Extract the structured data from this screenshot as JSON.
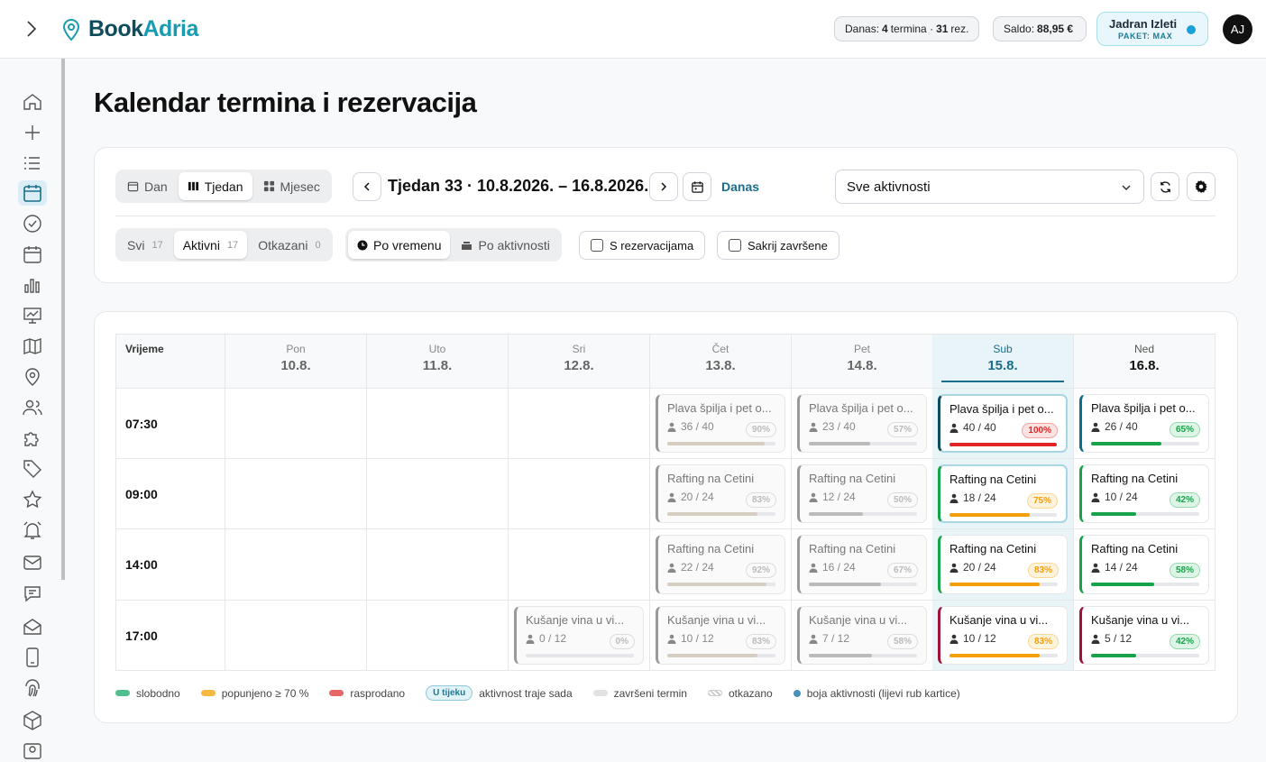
{
  "brand": {
    "part1": "Book",
    "part2": "Adria"
  },
  "header": {
    "today_label": "Danas:",
    "today_count": "4",
    "today_terms": "termina ·",
    "today_res": "31",
    "today_res_label": "rez.",
    "balance_label": "Saldo:",
    "balance_value": "88,95 €",
    "user_name": "Jadran Izleti",
    "user_plan": "PAKET: MAX",
    "avatar": "AJ"
  },
  "page": {
    "title": "Kalendar termina i rezervacija"
  },
  "toolbar": {
    "views": [
      "Dan",
      "Tjedan",
      "Mjesec"
    ],
    "week_title": "Tjedan 33 · 10.8.2026. – 16.8.2026.",
    "today_btn": "Danas",
    "activity_select": "Sve aktivnosti",
    "filters": [
      {
        "label": "Svi",
        "count": "17"
      },
      {
        "label": "Aktivni",
        "count": "17"
      },
      {
        "label": "Otkazani",
        "count": "0"
      }
    ],
    "sort": [
      "Po vremenu",
      "Po aktivnosti"
    ],
    "checks": [
      "S rezervacijama",
      "Sakrij završene"
    ]
  },
  "calendar": {
    "time_header": "Vrijeme",
    "days": [
      {
        "name": "Pon",
        "date": "10.8."
      },
      {
        "name": "Uto",
        "date": "11.8."
      },
      {
        "name": "Sri",
        "date": "12.8."
      },
      {
        "name": "Čet",
        "date": "13.8."
      },
      {
        "name": "Pet",
        "date": "14.8."
      },
      {
        "name": "Sub",
        "date": "15.8."
      },
      {
        "name": "Ned",
        "date": "16.8."
      }
    ],
    "times": [
      "07:30",
      "09:00",
      "14:00",
      "17:00"
    ],
    "events": [
      {
        "day": 3,
        "slot": 0,
        "title": "Plava špilja i pet o...",
        "count": "36 / 40",
        "pct": "90%",
        "fill": 90,
        "status": "past"
      },
      {
        "day": 4,
        "slot": 0,
        "title": "Plava špilja i pet o...",
        "count": "23 / 40",
        "pct": "57%",
        "fill": 57,
        "status": "past-gray"
      },
      {
        "day": 5,
        "slot": 0,
        "title": "Plava špilja i pet o...",
        "count": "40 / 40",
        "pct": "100%",
        "fill": 100,
        "status": "current",
        "bar_color": "#e02424",
        "edge": "#0f4c5c"
      },
      {
        "day": 6,
        "slot": 0,
        "title": "Plava špilja i pet o...",
        "count": "26 / 40",
        "pct": "65%",
        "fill": 65,
        "status": "active",
        "bar_color": "#16a34a",
        "edge": "#0f6e86"
      },
      {
        "day": 3,
        "slot": 1,
        "title": "Rafting na Cetini",
        "count": "20 / 24",
        "pct": "83%",
        "fill": 83,
        "status": "past"
      },
      {
        "day": 4,
        "slot": 1,
        "title": "Rafting na Cetini",
        "count": "12 / 24",
        "pct": "50%",
        "fill": 50,
        "status": "past-gray"
      },
      {
        "day": 5,
        "slot": 1,
        "title": "Rafting na Cetini",
        "count": "18 / 24",
        "pct": "75%",
        "fill": 75,
        "status": "current",
        "bar_color": "#f59e0b",
        "edge": "#16a34a"
      },
      {
        "day": 6,
        "slot": 1,
        "title": "Rafting na Cetini",
        "count": "10 / 24",
        "pct": "42%",
        "fill": 42,
        "status": "active",
        "bar_color": "#16a34a",
        "edge": "#16a34a"
      },
      {
        "day": 3,
        "slot": 2,
        "title": "Rafting na Cetini",
        "count": "22 / 24",
        "pct": "92%",
        "fill": 92,
        "status": "past"
      },
      {
        "day": 4,
        "slot": 2,
        "title": "Rafting na Cetini",
        "count": "16 / 24",
        "pct": "67%",
        "fill": 67,
        "status": "past-gray"
      },
      {
        "day": 5,
        "slot": 2,
        "title": "Rafting na Cetini",
        "count": "20 / 24",
        "pct": "83%",
        "fill": 83,
        "status": "active",
        "bar_color": "#f59e0b",
        "edge": "#16a34a"
      },
      {
        "day": 6,
        "slot": 2,
        "title": "Rafting na Cetini",
        "count": "14 / 24",
        "pct": "58%",
        "fill": 58,
        "status": "active",
        "bar_color": "#16a34a",
        "edge": "#16a34a"
      },
      {
        "day": 2,
        "slot": 3,
        "title": "Kušanje vina u vi...",
        "count": "0 / 12",
        "pct": "0%",
        "fill": 0,
        "status": "past"
      },
      {
        "day": 3,
        "slot": 3,
        "title": "Kušanje vina u vi...",
        "count": "10 / 12",
        "pct": "83%",
        "fill": 83,
        "status": "past"
      },
      {
        "day": 4,
        "slot": 3,
        "title": "Kušanje vina u vi...",
        "count": "7 / 12",
        "pct": "58%",
        "fill": 58,
        "status": "past-gray"
      },
      {
        "day": 5,
        "slot": 3,
        "title": "Kušanje vina u vi...",
        "count": "10 / 12",
        "pct": "83%",
        "fill": 83,
        "status": "active",
        "bar_color": "#f59e0b",
        "edge": "#9f1239"
      },
      {
        "day": 6,
        "slot": 3,
        "title": "Kušanje vina u vi...",
        "count": "5 / 12",
        "pct": "42%",
        "fill": 42,
        "status": "active",
        "bar_color": "#16a34a",
        "edge": "#9f1239"
      }
    ]
  },
  "legend": {
    "free": "slobodno",
    "filled": "popunjeno ≥ 70 %",
    "sold": "rasprodano",
    "ongoing_tag": "U tijeku",
    "ongoing": "aktivnost traje sada",
    "done": "završeni termin",
    "cancelled": "otkazano",
    "color_note": "boja aktivnosti (lijevi rub kartice)"
  },
  "colors": {
    "brand_dark": "#0f4c5c",
    "brand_light": "#1a9cb0",
    "free": "#4fc08d",
    "filled": "#f5b942",
    "sold": "#e56767"
  }
}
